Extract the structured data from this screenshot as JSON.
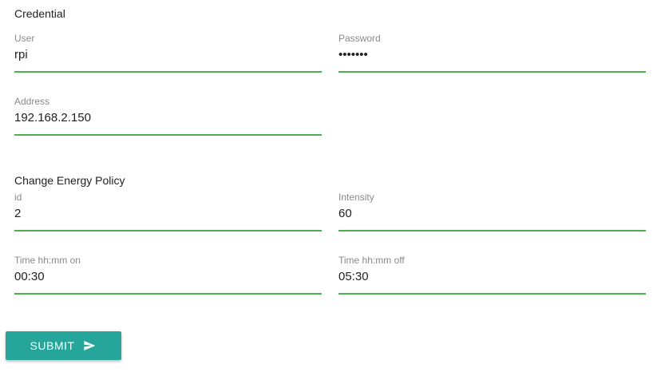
{
  "credential": {
    "title": "Credential",
    "user": {
      "label": "User",
      "value": "rpi"
    },
    "password": {
      "label": "Password",
      "value": "•••••••"
    },
    "address": {
      "label": "Address",
      "value": "192.168.2.150"
    }
  },
  "energy_policy": {
    "title": "Change Energy Policy",
    "id": {
      "label": "id",
      "value": "2"
    },
    "intensity": {
      "label": "Intensity",
      "value": "60"
    },
    "time_on": {
      "label": "Time hh:mm on",
      "value": "00:30"
    },
    "time_off": {
      "label": "Time hh:mm off",
      "value": "05:30"
    }
  },
  "submit": {
    "label": "SUBMIT",
    "icon": "send-icon"
  },
  "colors": {
    "accent": "#4caf50",
    "button": "#26a69a",
    "label": "#8a8a8a"
  }
}
